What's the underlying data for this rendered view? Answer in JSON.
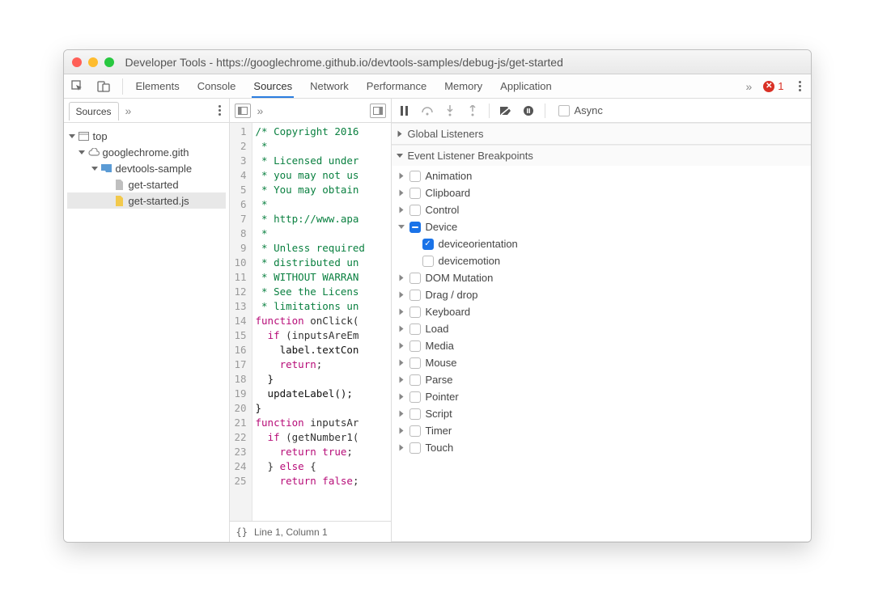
{
  "window_title": "Developer Tools - https://googlechrome.github.io/devtools-samples/debug-js/get-started",
  "main_tabs": [
    "Elements",
    "Console",
    "Sources",
    "Network",
    "Performance",
    "Memory",
    "Application"
  ],
  "active_tab": "Sources",
  "error_count": "1",
  "nav": {
    "tab": "Sources",
    "tree": {
      "root": "top",
      "domain": "googlechrome.gith",
      "folder": "devtools-sample",
      "files": [
        "get-started",
        "get-started.js"
      ],
      "selected": "get-started.js"
    }
  },
  "code": {
    "lines": [
      {
        "n": "1",
        "txt": "/* Copyright 2016",
        "cls": "c-comment"
      },
      {
        "n": "2",
        "txt": " *",
        "cls": "c-comment"
      },
      {
        "n": "3",
        "txt": " * Licensed under",
        "cls": "c-comment"
      },
      {
        "n": "4",
        "txt": " * you may not us",
        "cls": "c-comment"
      },
      {
        "n": "5",
        "txt": " * You may obtain",
        "cls": "c-comment"
      },
      {
        "n": "6",
        "txt": " *",
        "cls": "c-comment"
      },
      {
        "n": "7",
        "txt": " * http://www.apa",
        "cls": "c-comment"
      },
      {
        "n": "8",
        "txt": " *",
        "cls": "c-comment"
      },
      {
        "n": "9",
        "txt": " * Unless required",
        "cls": "c-comment"
      },
      {
        "n": "10",
        "txt": " * distributed un",
        "cls": "c-comment"
      },
      {
        "n": "11",
        "txt": " * WITHOUT WARRAN",
        "cls": "c-comment"
      },
      {
        "n": "12",
        "txt": " * See the Licens",
        "cls": "c-comment"
      },
      {
        "n": "13",
        "txt": " * limitations un",
        "cls": "c-comment"
      },
      {
        "n": "14",
        "txt": "function onClick(",
        "cls": "mix1"
      },
      {
        "n": "15",
        "txt": "  if (inputsAreEm",
        "cls": "mix2"
      },
      {
        "n": "16",
        "txt": "    label.textCon",
        "cls": "c-fn"
      },
      {
        "n": "17",
        "txt": "    return;",
        "cls": "mix3"
      },
      {
        "n": "18",
        "txt": "  }",
        "cls": "c-fn"
      },
      {
        "n": "19",
        "txt": "  updateLabel();",
        "cls": "c-fn"
      },
      {
        "n": "20",
        "txt": "}",
        "cls": "c-fn"
      },
      {
        "n": "21",
        "txt": "function inputsAr",
        "cls": "mix1"
      },
      {
        "n": "22",
        "txt": "  if (getNumber1(",
        "cls": "mix2"
      },
      {
        "n": "23",
        "txt": "    return true;",
        "cls": "mix3"
      },
      {
        "n": "24",
        "txt": "  } else {",
        "cls": "mix2"
      },
      {
        "n": "25",
        "txt": "    return false;",
        "cls": "mix3"
      }
    ],
    "footer": "Line 1, Column 1"
  },
  "debugger": {
    "async_label": "Async",
    "sections": {
      "global": "Global Listeners",
      "events": "Event Listener Breakpoints"
    },
    "categories": [
      {
        "label": "Animation",
        "expanded": false,
        "state": "off"
      },
      {
        "label": "Clipboard",
        "expanded": false,
        "state": "off"
      },
      {
        "label": "Control",
        "expanded": false,
        "state": "off"
      },
      {
        "label": "Device",
        "expanded": true,
        "state": "mixed",
        "children": [
          {
            "label": "deviceorientation",
            "state": "on"
          },
          {
            "label": "devicemotion",
            "state": "off"
          }
        ]
      },
      {
        "label": "DOM Mutation",
        "expanded": false,
        "state": "off"
      },
      {
        "label": "Drag / drop",
        "expanded": false,
        "state": "off"
      },
      {
        "label": "Keyboard",
        "expanded": false,
        "state": "off"
      },
      {
        "label": "Load",
        "expanded": false,
        "state": "off"
      },
      {
        "label": "Media",
        "expanded": false,
        "state": "off"
      },
      {
        "label": "Mouse",
        "expanded": false,
        "state": "off"
      },
      {
        "label": "Parse",
        "expanded": false,
        "state": "off"
      },
      {
        "label": "Pointer",
        "expanded": false,
        "state": "off"
      },
      {
        "label": "Script",
        "expanded": false,
        "state": "off"
      },
      {
        "label": "Timer",
        "expanded": false,
        "state": "off"
      },
      {
        "label": "Touch",
        "expanded": false,
        "state": "off"
      }
    ]
  }
}
